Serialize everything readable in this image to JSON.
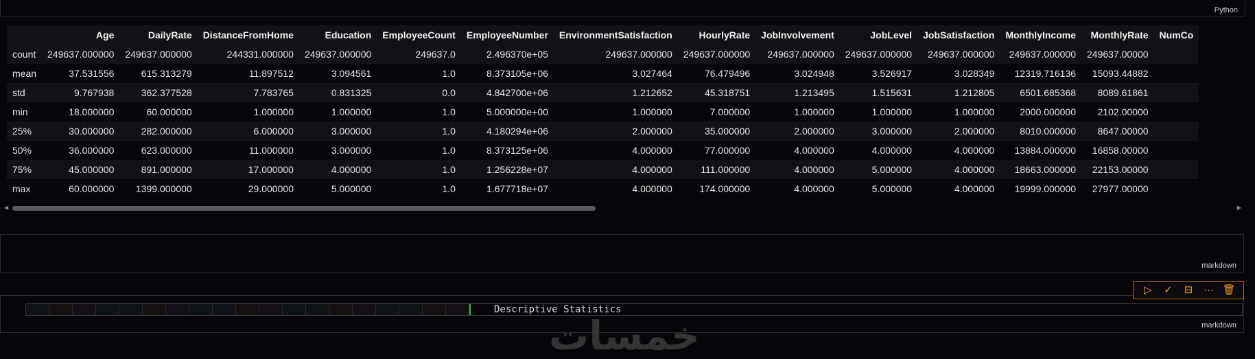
{
  "top_cell": {
    "language": "Python"
  },
  "describe_table": {
    "columns": [
      "Age",
      "DailyRate",
      "DistanceFromHome",
      "Education",
      "EmployeeCount",
      "EmployeeNumber",
      "EnvironmentSatisfaction",
      "HourlyRate",
      "JobInvolvement",
      "JobLevel",
      "JobSatisfaction",
      "MonthlyIncome",
      "MonthlyRate",
      "NumCo"
    ],
    "rows": [
      {
        "label": "count",
        "values": [
          "249637.000000",
          "249637.000000",
          "244331.000000",
          "249637.000000",
          "249637.0",
          "2.496370e+05",
          "249637.000000",
          "249637.000000",
          "249637.000000",
          "249637.000000",
          "249637.000000",
          "249637.000000",
          "249637.00000",
          ""
        ]
      },
      {
        "label": "mean",
        "values": [
          "37.531556",
          "615.313279",
          "11.897512",
          "3.094561",
          "1.0",
          "8.373105e+06",
          "3.027464",
          "76.479496",
          "3.024948",
          "3.526917",
          "3.028349",
          "12319.716136",
          "15093.44882",
          ""
        ]
      },
      {
        "label": "std",
        "values": [
          "9.767938",
          "362.377528",
          "7.783765",
          "0.831325",
          "0.0",
          "4.842700e+06",
          "1.212652",
          "45.318751",
          "1.213495",
          "1.515631",
          "1.212805",
          "6501.685368",
          "8089.61861",
          ""
        ]
      },
      {
        "label": "min",
        "values": [
          "18.000000",
          "60.000000",
          "1.000000",
          "1.000000",
          "1.0",
          "5.000000e+00",
          "1.000000",
          "7.000000",
          "1.000000",
          "1.000000",
          "1.000000",
          "2000.000000",
          "2102.00000",
          ""
        ]
      },
      {
        "label": "25%",
        "values": [
          "30.000000",
          "282.000000",
          "6.000000",
          "3.000000",
          "1.0",
          "4.180294e+06",
          "2.000000",
          "35.000000",
          "2.000000",
          "3.000000",
          "2.000000",
          "8010.000000",
          "8647.00000",
          ""
        ]
      },
      {
        "label": "50%",
        "values": [
          "36.000000",
          "623.000000",
          "11.000000",
          "3.000000",
          "1.0",
          "8.373125e+06",
          "4.000000",
          "77.000000",
          "4.000000",
          "4.000000",
          "4.000000",
          "13884.000000",
          "16858.00000",
          ""
        ]
      },
      {
        "label": "75%",
        "values": [
          "45.000000",
          "891.000000",
          "17.000000",
          "4.000000",
          "1.0",
          "1.256228e+07",
          "4.000000",
          "111.000000",
          "4.000000",
          "5.000000",
          "4.000000",
          "18663.000000",
          "22153.00000",
          ""
        ]
      },
      {
        "label": "max",
        "values": [
          "60.000000",
          "1399.000000",
          "29.000000",
          "5.000000",
          "1.0",
          "1.677718e+07",
          "4.000000",
          "174.000000",
          "4.000000",
          "5.000000",
          "4.000000",
          "19999.000000",
          "27977.00000",
          ""
        ]
      }
    ]
  },
  "empty_md_cell": {
    "language": "markdown"
  },
  "toolbar": {
    "run": "▷",
    "check": "✓",
    "split": "⊟",
    "more": "···",
    "delete": "🗑"
  },
  "active_md_cell": {
    "language": "markdown",
    "source": "Descriptive Statistics"
  },
  "watermark": "خمسات"
}
